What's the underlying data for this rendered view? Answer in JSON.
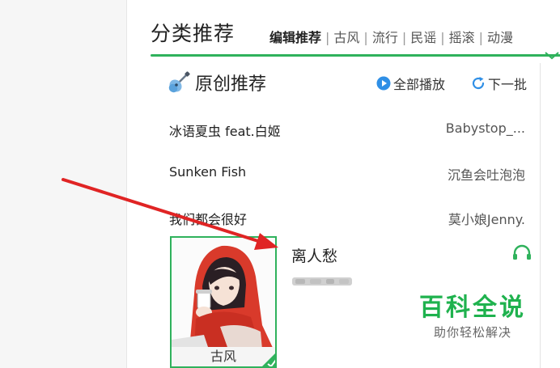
{
  "header": {
    "title": "分类推荐",
    "tabs": [
      {
        "label": "编辑推荐",
        "active": true
      },
      {
        "label": "古风",
        "active": false
      },
      {
        "label": "流行",
        "active": false
      },
      {
        "label": "民谣",
        "active": false
      },
      {
        "label": "摇滚",
        "active": false
      },
      {
        "label": "动漫",
        "active": false
      }
    ],
    "tab_separator": "|"
  },
  "card": {
    "title": "原创推荐",
    "icon": "guitar-icon",
    "play_all_label": "全部播放",
    "next_batch_label": "下一批",
    "songs": [
      {
        "title": "冰语夏虫 feat.白姬",
        "artist": "Babystop_..."
      },
      {
        "title": "Sunken Fish",
        "artist": "沉鱼会吐泡泡"
      },
      {
        "title": "我们都会很好",
        "artist": "莫小娘Jenny."
      }
    ],
    "featured": {
      "title": "离人愁",
      "tag": "古风",
      "icon": "headphones-icon"
    }
  },
  "watermark": {
    "main": "百科全说",
    "sub": "助你轻松解决"
  },
  "colors": {
    "accent": "#2fb25c",
    "play_icon": "#2f8fe6",
    "annotation_arrow": "#e02424",
    "watermark": "#1fb24e"
  }
}
